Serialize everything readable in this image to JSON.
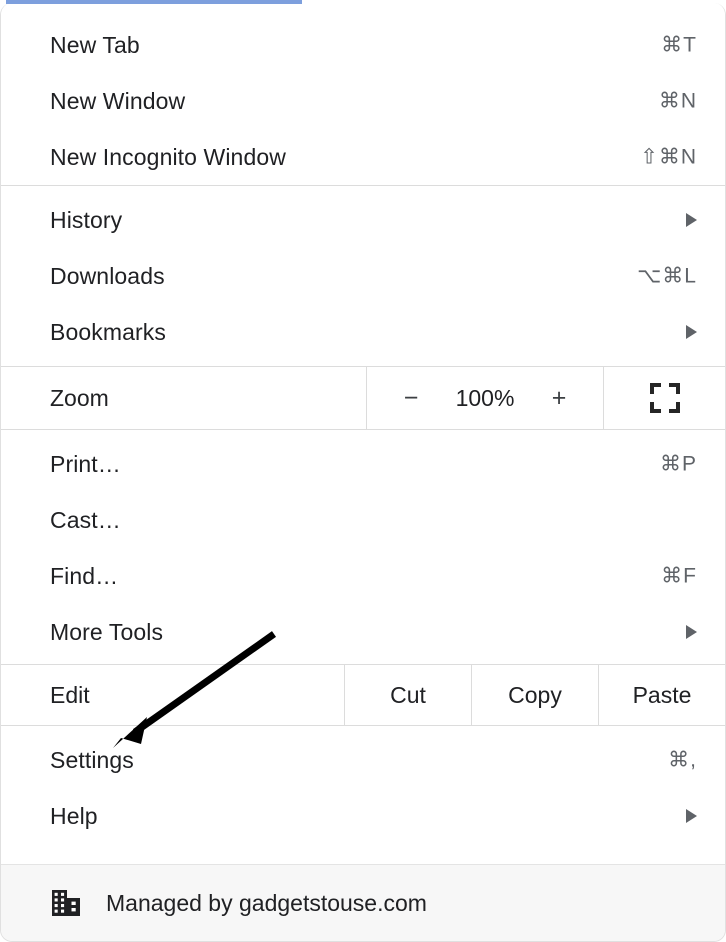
{
  "menu": {
    "accent_color": "#7d9fdd",
    "background": "#ffffff",
    "divider_color": "#dcdcdc",
    "sections": [
      {
        "name": "new",
        "items": [
          {
            "label": "New Tab",
            "shortcut": "⌘T",
            "has_submenu": false
          },
          {
            "label": "New Window",
            "shortcut": "⌘N",
            "has_submenu": false
          },
          {
            "label": "New Incognito Window",
            "shortcut": "⇧⌘N",
            "has_submenu": false
          }
        ]
      },
      {
        "name": "browse",
        "items": [
          {
            "label": "History",
            "shortcut": "",
            "has_submenu": true
          },
          {
            "label": "Downloads",
            "shortcut": "⌥⌘L",
            "has_submenu": false
          },
          {
            "label": "Bookmarks",
            "shortcut": "",
            "has_submenu": true
          }
        ]
      },
      {
        "name": "page",
        "items": [
          {
            "label": "Print…",
            "shortcut": "⌘P",
            "has_submenu": false
          },
          {
            "label": "Cast…",
            "shortcut": "",
            "has_submenu": false
          },
          {
            "label": "Find…",
            "shortcut": "⌘F",
            "has_submenu": false
          },
          {
            "label": "More Tools",
            "shortcut": "",
            "has_submenu": true
          }
        ]
      },
      {
        "name": "settings",
        "items": [
          {
            "label": "Settings",
            "shortcut": "⌘,",
            "has_submenu": false
          },
          {
            "label": "Help",
            "shortcut": "",
            "has_submenu": true
          }
        ]
      }
    ],
    "zoom_row": {
      "label": "Zoom",
      "decrease_label": "−",
      "value": "100%",
      "increase_label": "+",
      "fullscreen_icon": "fullscreen-icon"
    },
    "edit_row": {
      "label": "Edit",
      "actions": [
        "Cut",
        "Copy",
        "Paste"
      ]
    },
    "footer": {
      "icon": "building-icon",
      "text": "Managed by gadgetstouse.com"
    }
  },
  "annotation": {
    "type": "arrow",
    "color": "#000000",
    "points_to": "Settings"
  }
}
